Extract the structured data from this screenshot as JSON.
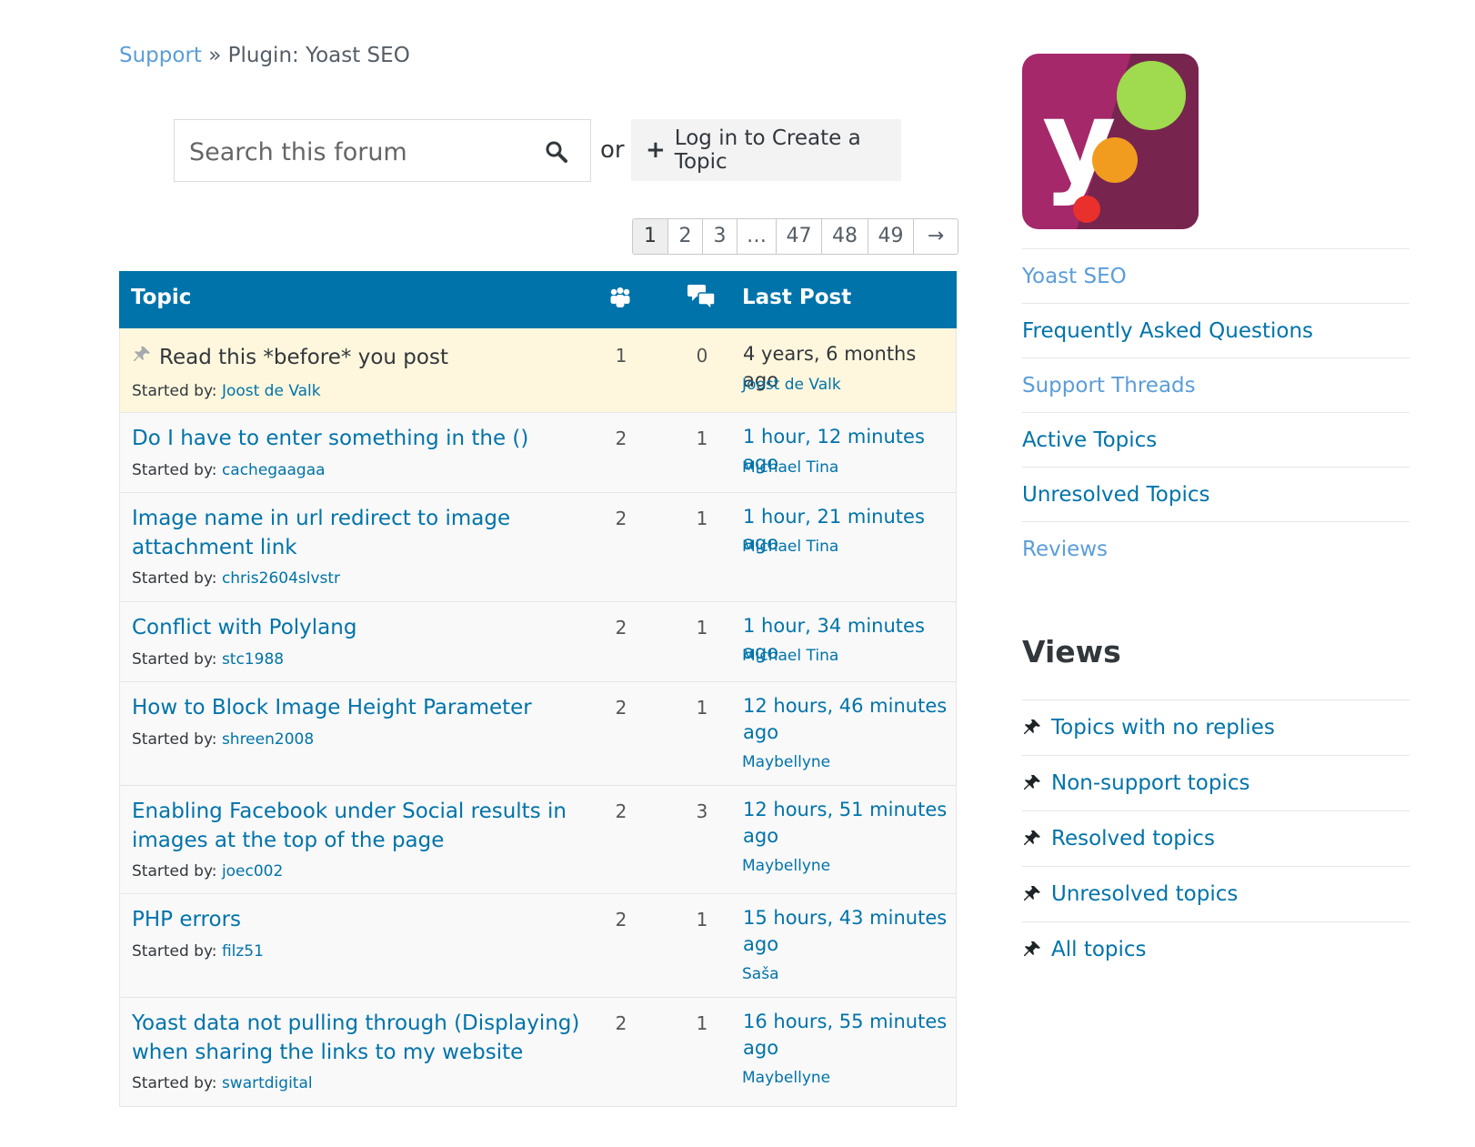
{
  "breadcrumb": {
    "root": "Support",
    "sep": "»",
    "current": "Plugin: Yoast SEO"
  },
  "search": {
    "placeholder": "Search this forum"
  },
  "or_text": "or",
  "create_topic": {
    "icon": "plus-icon",
    "label": "Log in to Create a Topic"
  },
  "pagination": {
    "pages": [
      "1",
      "2",
      "3",
      "…",
      "47",
      "48",
      "49",
      "→"
    ],
    "current": "1"
  },
  "table": {
    "header": {
      "topic": "Topic",
      "last_post": "Last Post",
      "voices_icon": "people-icon",
      "replies_icon": "speech-bubbles-icon"
    },
    "started_by_label": "Started by:",
    "rows": [
      {
        "title": "Read this *before* you post",
        "author": "Joost de Valk",
        "voices": "1",
        "replies": "0",
        "freshness": "4 years, 6 months ago",
        "last_author": "Joost de Valk",
        "sticky": true
      },
      {
        "title": "Do I have to enter something in the ()",
        "author": "cachegaagaa",
        "voices": "2",
        "replies": "1",
        "freshness": "1 hour, 12 minutes ago",
        "last_author": "Michael Tina"
      },
      {
        "title": "Image name in url redirect to image attachment link",
        "author": "chris2604slvstr",
        "voices": "2",
        "replies": "1",
        "freshness": "1 hour, 21 minutes ago",
        "last_author": "Michael Tina"
      },
      {
        "title": "Conflict with Polylang",
        "author": "stc1988",
        "voices": "2",
        "replies": "1",
        "freshness": "1 hour, 34 minutes ago",
        "last_author": "Michael Tina"
      },
      {
        "title": "How to Block Image Height Parameter",
        "author": "shreen2008",
        "voices": "2",
        "replies": "1",
        "freshness": "12 hours, 46 minutes ago",
        "last_author": "Maybellyne"
      },
      {
        "title": "Enabling Facebook under Social results in images at the top of the page",
        "author": "joec002",
        "voices": "2",
        "replies": "3",
        "freshness": "12 hours, 51 minutes ago",
        "last_author": "Maybellyne"
      },
      {
        "title": "PHP errors",
        "author": "filz51",
        "voices": "2",
        "replies": "1",
        "freshness": "15 hours, 43 minutes ago",
        "last_author": "Saša"
      },
      {
        "title": "Yoast data not pulling through (Displaying) when sharing the links to my website",
        "author": "swartdigital",
        "voices": "2",
        "replies": "1",
        "freshness": "16 hours, 55 minutes ago",
        "last_author": "Maybellyne"
      }
    ]
  },
  "sidebar": {
    "nav": [
      "Yoast SEO",
      "Frequently Asked Questions",
      "Support Threads",
      "Active Topics",
      "Unresolved Topics",
      "Reviews"
    ],
    "views_title": "Views",
    "views": [
      "Topics with no replies",
      "Non-support topics",
      "Resolved topics",
      "Unresolved topics",
      "All topics"
    ],
    "views_icon": "pushpin-icon"
  },
  "colors": {
    "header_bg": "#0073aa",
    "link": "#0073aa",
    "sticky_bg": "#fef7dd",
    "logo_bg": "#a4286a"
  }
}
